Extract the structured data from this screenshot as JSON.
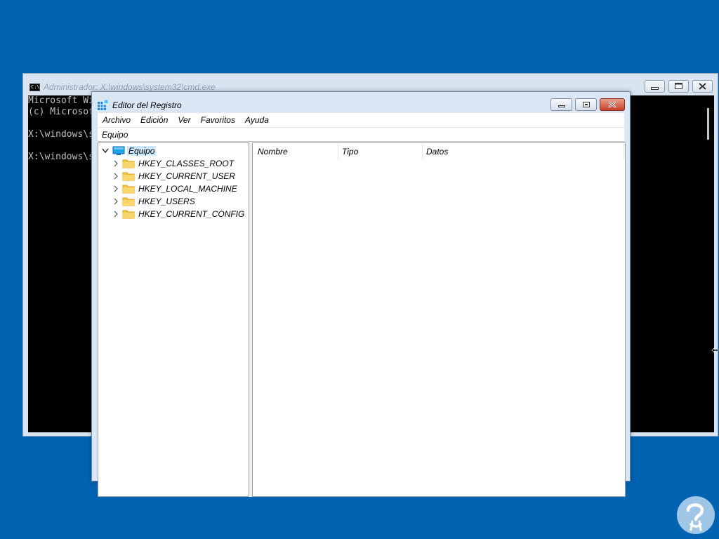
{
  "cmd_window": {
    "title": "Administrador: X:\\windows\\system32\\cmd.exe",
    "icon_text": "C:\\.",
    "console_lines": [
      "Microsoft Wi",
      "(c) Microsof",
      "",
      "X:\\windows\\s",
      "",
      "X:\\windows\\s"
    ],
    "controls": {
      "minimize": "minimize",
      "maximize": "maximize",
      "close": "close"
    }
  },
  "regedit": {
    "title": "Editor del Registro",
    "menu": [
      "Archivo",
      "Edición",
      "Ver",
      "Favoritos",
      "Ayuda"
    ],
    "address": "Equipo",
    "tree": {
      "root": "Equipo",
      "children": [
        "HKEY_CLASSES_ROOT",
        "HKEY_CURRENT_USER",
        "HKEY_LOCAL_MACHINE",
        "HKEY_USERS",
        "HKEY_CURRENT_CONFIG"
      ]
    },
    "columns": [
      "Nombre",
      "Tipo",
      "Datos"
    ]
  },
  "colors": {
    "desktop": "#0063b1",
    "window_frame": "#dbe6f4",
    "selection": "#cce8ff",
    "folder": "#f6c343",
    "close_button": "#c8402a"
  },
  "icons": {
    "cmd": "cmd-icon",
    "regedit": "regedit-icon",
    "computer": "computer-icon",
    "folder": "folder-icon",
    "expand": "chevron-right-icon",
    "collapse": "chevron-down-icon",
    "logo": "help-logo-icon",
    "cursor": "resize-cursor-icon"
  }
}
